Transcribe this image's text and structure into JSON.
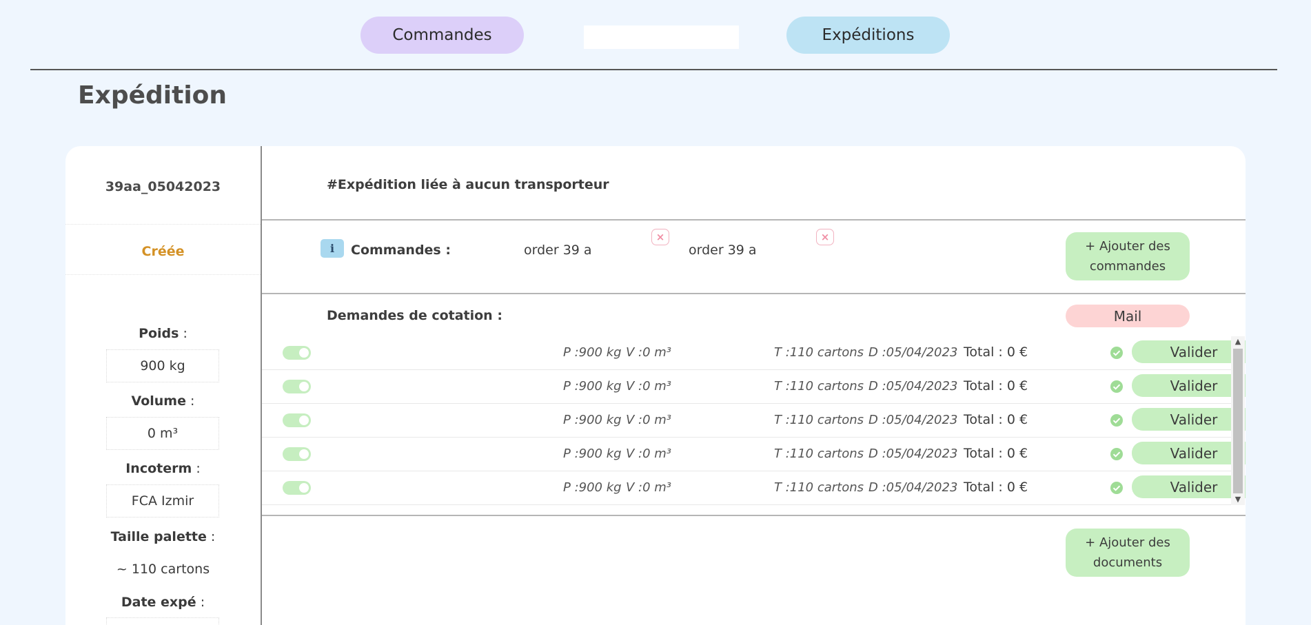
{
  "nav": {
    "commandes_label": "Commandes",
    "expeditions_label": "Expéditions",
    "search_value": ""
  },
  "page": {
    "title": "Expédition"
  },
  "summary": {
    "id": "39aa_05042023",
    "status": "Créée",
    "poids_label": "Poids",
    "poids_value": "900 kg",
    "volume_label": "Volume",
    "volume_value": "0 m³",
    "incoterm_label": "Incoterm",
    "incoterm_value": "FCA Izmir",
    "palette_label": "Taille palette",
    "palette_value": "~ 110 cartons",
    "date_label": "Date expé",
    "colon": " :"
  },
  "carrier": {
    "title": "#Expédition liée à aucun transporteur"
  },
  "commandes": {
    "label": "Commandes :",
    "orders": [
      "order 39 a",
      "order 39 a"
    ],
    "add_label": "+ Ajouter des commandes"
  },
  "quotes": {
    "title": "Demandes de cotation :",
    "mail_label": "Mail",
    "rows": [
      {
        "p": "P :900 kg",
        "v": "V :0 m³",
        "t": "T :110 cartons",
        "d": "D :05/04/2023",
        "total": "Total : 0 €",
        "action": "Valider"
      },
      {
        "p": "P :900 kg",
        "v": "V :0 m³",
        "t": "T :110 cartons",
        "d": "D :05/04/2023",
        "total": "Total : 0 €",
        "action": "Valider"
      },
      {
        "p": "P :900 kg",
        "v": "V :0 m³",
        "t": "T :110 cartons",
        "d": "D :05/04/2023",
        "total": "Total : 0 €",
        "action": "Valider"
      },
      {
        "p": "P :900 kg",
        "v": "V :0 m³",
        "t": "T :110 cartons",
        "d": "D :05/04/2023",
        "total": "Total : 0 €",
        "action": "Valider"
      },
      {
        "p": "P :900 kg",
        "v": "V :0 m³",
        "t": "T :110 cartons",
        "d": "D :05/04/2023",
        "total": "Total : 0 €",
        "action": "Valider"
      }
    ]
  },
  "documents": {
    "add_label": "+ Ajouter des documents"
  },
  "icons": {
    "info": "info-icon",
    "remove": "close-icon",
    "check": "check-circle-icon",
    "toggle": "toggle-icon"
  },
  "colors": {
    "page_bg": "#eff6fe",
    "commandes_pill": "#dccff9",
    "expeditions_pill": "#bde3f4",
    "status": "#d49125",
    "green_button": "#c7efc1",
    "mail_button": "#fdd4d4",
    "check": "#9fdc96"
  }
}
